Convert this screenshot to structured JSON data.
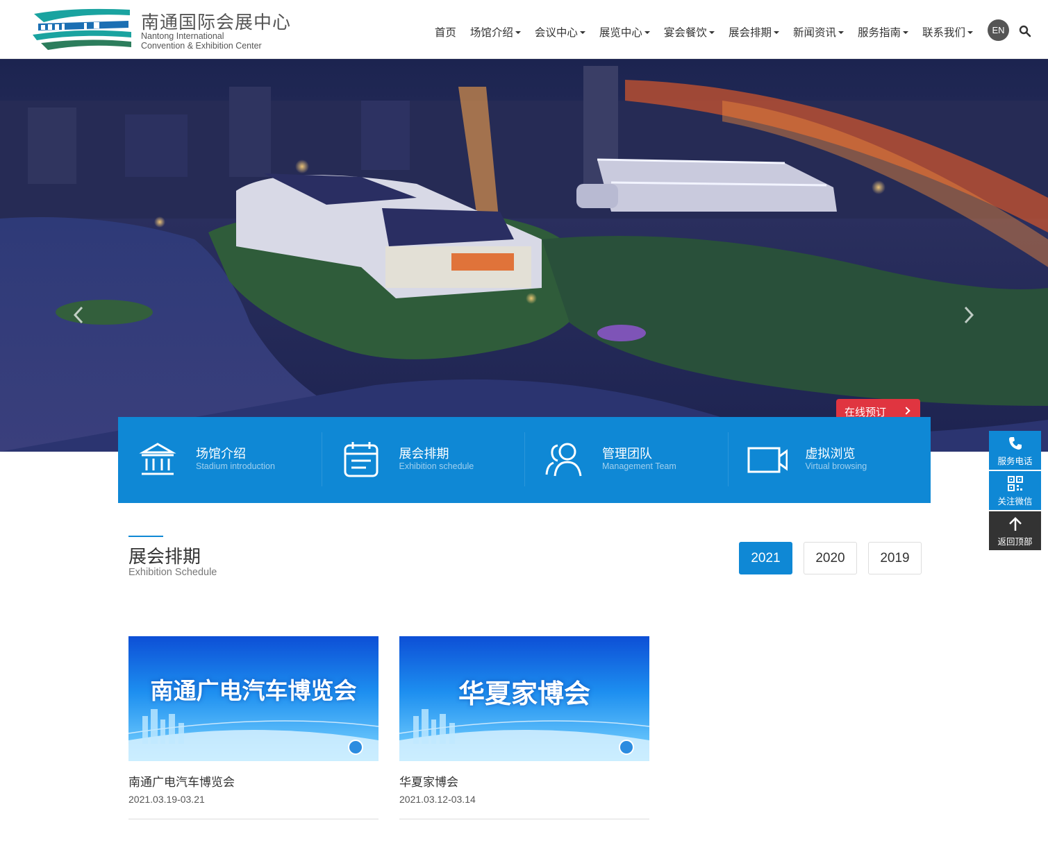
{
  "brand": {
    "name_cn": "南通国际会展中心",
    "name_en_line1": "Nantong International",
    "name_en_line2": "Convention & Exhibition Center"
  },
  "nav": {
    "items": [
      {
        "label": "首页",
        "dropdown": false
      },
      {
        "label": "场馆介绍",
        "dropdown": true
      },
      {
        "label": "会议中心",
        "dropdown": true
      },
      {
        "label": "展览中心",
        "dropdown": true
      },
      {
        "label": "宴会餐饮",
        "dropdown": true
      },
      {
        "label": "展会排期",
        "dropdown": true
      },
      {
        "label": "新闻资讯",
        "dropdown": true
      },
      {
        "label": "服务指南",
        "dropdown": true
      },
      {
        "label": "联系我们",
        "dropdown": true
      }
    ],
    "lang_label": "EN",
    "search_icon": "search-icon"
  },
  "banner": {
    "book_label": "在线预订"
  },
  "quicklinks": [
    {
      "cn": "场馆介绍",
      "en": "Stadium introduction",
      "icon": "building-icon"
    },
    {
      "cn": "展会排期",
      "en": "Exhibition schedule",
      "icon": "calendar-icon"
    },
    {
      "cn": "管理团队",
      "en": "Management Team",
      "icon": "team-icon"
    },
    {
      "cn": "虚拟浏览",
      "en": "Virtual browsing",
      "icon": "video-icon"
    }
  ],
  "side": {
    "phone_label": "服务电话",
    "wechat_label": "关注微信",
    "top_label": "返回顶部"
  },
  "section": {
    "title": "展会排期",
    "subtitle": "Exhibition Schedule",
    "years": [
      "2021",
      "2020",
      "2019"
    ],
    "active_year": "2021"
  },
  "exhibitions": [
    {
      "image_title": "南通广电汽车博览会",
      "name": "南通广电汽车博览会",
      "date": "2021.03.19-03.21"
    },
    {
      "image_title": "华夏家博会",
      "name": "华夏家博会",
      "date": "2021.03.12-03.14"
    }
  ],
  "colors": {
    "primary": "#0f88d5",
    "book": "#e03540",
    "dark": "#333333"
  }
}
